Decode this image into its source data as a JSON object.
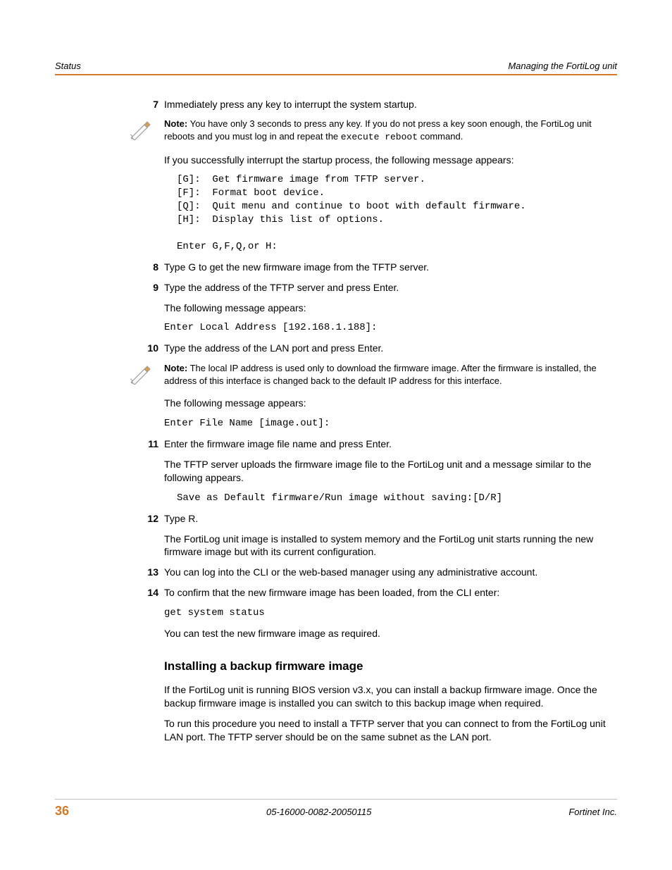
{
  "header": {
    "left": "Status",
    "right": "Managing the FortiLog unit"
  },
  "steps": {
    "s7": {
      "num": "7",
      "text": "Immediately press any key to interrupt the system startup."
    },
    "note1": {
      "bold": "Note:",
      "rest": " You have only 3 seconds to press any key. If you do not press a key soon enough, the FortiLog unit reboots and you must log in and repeat the ",
      "code": "execute reboot",
      "tail": " command."
    },
    "after7a": "If you successfully interrupt the startup process, the following message appears:",
    "menu": "[G]:  Get firmware image from TFTP server.\n[F]:  Format boot device.\n[Q]:  Quit menu and continue to boot with default firmware.\n[H]:  Display this list of options.\n\nEnter G,F,Q,or H:",
    "s8": {
      "num": "8",
      "text": "Type G to get the new firmware image from the TFTP server."
    },
    "s9": {
      "num": "9",
      "text": "Type the address of the TFTP server and press Enter."
    },
    "after9a": "The following message appears:",
    "after9b": "Enter Local Address [192.168.1.188]:",
    "s10": {
      "num": "10",
      "text": "Type the address of the LAN port and press Enter."
    },
    "note2": {
      "bold": "Note:",
      "rest": " The local IP address is used only to download the firmware image. After the firmware is installed, the address of this interface is changed back to the default IP address for this interface."
    },
    "after10a": "The following message appears:",
    "after10b": "Enter File Name [image.out]:",
    "s11": {
      "num": "11",
      "text": "Enter the firmware image file name and press Enter."
    },
    "after11a": "The TFTP server uploads the firmware image file to the FortiLog unit and a message similar to the following appears.",
    "after11b": "Save as Default firmware/Run image without saving:[D/R]",
    "s12": {
      "num": "12",
      "text": "Type R."
    },
    "after12a": "The FortiLog unit image is installed to system memory and the FortiLog unit starts running the new firmware image but with its current configuration.",
    "s13": {
      "num": "13",
      "text": "You can log into the CLI or the web-based manager using any administrative account."
    },
    "s14": {
      "num": "14",
      "text": "To confirm that the new firmware image has been loaded, from the CLI enter:"
    },
    "after14a": "get system status",
    "after14b": "You can test the new firmware image as required."
  },
  "section": {
    "title": "Installing a backup firmware image",
    "p1": "If the FortiLog unit is running BIOS version v3.x, you can install a backup firmware image. Once the backup firmware image is installed you can switch to this backup image when required.",
    "p2": "To run this procedure you need to install a TFTP server that you can connect to from the FortiLog unit LAN port. The TFTP server should be on the same subnet as the LAN port."
  },
  "footer": {
    "page": "36",
    "mid": "05-16000-0082-20050115",
    "right": "Fortinet Inc."
  }
}
